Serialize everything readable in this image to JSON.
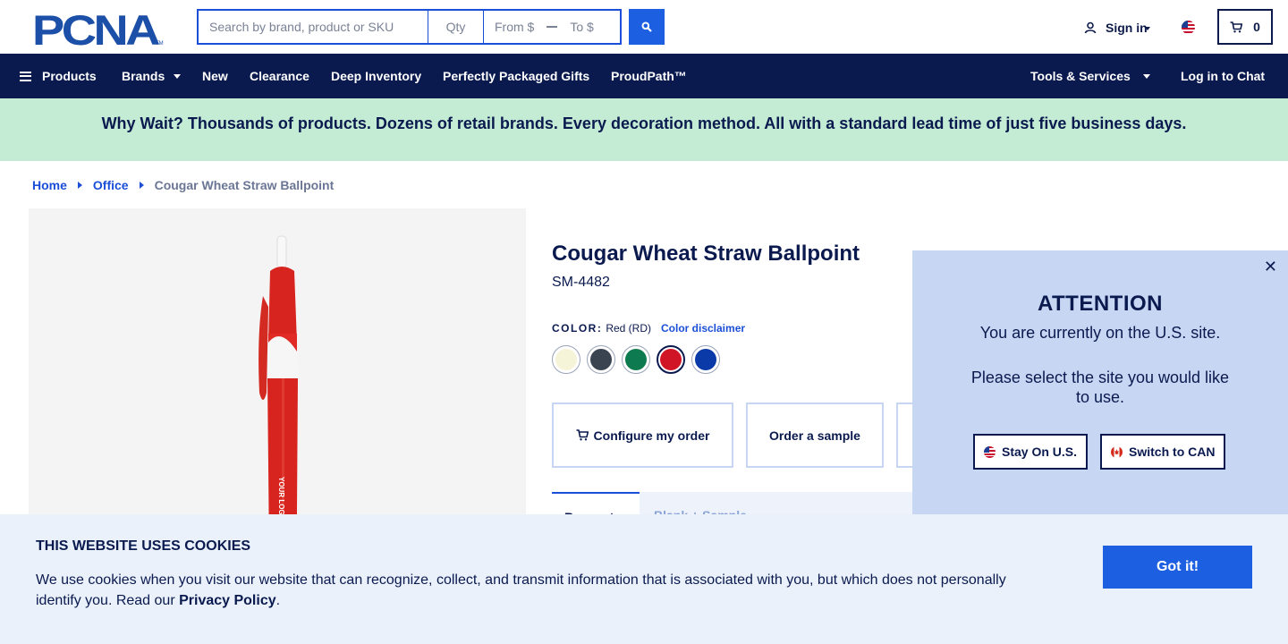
{
  "header": {
    "logo_text": "PCNA",
    "logo_mark": "TM",
    "search_placeholder": "Search by brand, product or SKU",
    "qty_placeholder": "Qty",
    "from_placeholder": "From $",
    "to_placeholder": "To $",
    "signin_label": "Sign in",
    "cart_count": "0"
  },
  "nav": {
    "products": "Products",
    "brands": "Brands",
    "new": "New",
    "clearance": "Clearance",
    "deep_inventory": "Deep Inventory",
    "gifts": "Perfectly Packaged Gifts",
    "proudpath": "ProudPath™",
    "tools": "Tools & Services",
    "chat": "Log in to Chat"
  },
  "banner": {
    "text": "Why Wait? Thousands of products. Dozens of retail brands. Every decoration method. All with a standard lead time of just five business days."
  },
  "breadcrumb": {
    "home": "Home",
    "office": "Office",
    "current": "Cougar Wheat Straw Ballpoint"
  },
  "product": {
    "title": "Cougar Wheat Straw Ballpoint",
    "sku": "SM-4482",
    "color_label": "COLOR:",
    "color_value": "Red (RD)",
    "color_disclaimer": "Color disclaimer",
    "pen_imprint": "YOUR LOGO BY URBAN",
    "swatches": [
      {
        "name": "cream",
        "color": "#f5f3d8"
      },
      {
        "name": "charcoal",
        "color": "#3a4450"
      },
      {
        "name": "green",
        "color": "#0d7a4f"
      },
      {
        "name": "red",
        "color": "#d01526"
      },
      {
        "name": "blue",
        "color": "#0a3aa8"
      }
    ],
    "selected_swatch": 3,
    "configure_label": "Configure my order",
    "sample_label": "Order a sample",
    "tab1_label": "Request",
    "tab2_label": "Blank + Sample"
  },
  "attention": {
    "title": "ATTENTION",
    "line1": "You are currently on the U.S. site.",
    "line2": "Please select the site you would like to use.",
    "stay_label": "Stay On U.S.",
    "switch_label": "Switch to CAN"
  },
  "cookie": {
    "title": "THIS WEBSITE USES COOKIES",
    "text": "We use cookies when you visit our website that can recognize, collect, and transmit information that is associated with you, but which does not personally identify you. Read our ",
    "policy_link": "Privacy Policy",
    "period": ".",
    "button": "Got it!"
  },
  "colors": {
    "navy": "#0a1a4f",
    "accent_blue": "#1c5fe0",
    "banner_green": "#c4ecd4",
    "modal_bg": "#c7d6f2",
    "cookie_bg": "#eaf1fb"
  }
}
